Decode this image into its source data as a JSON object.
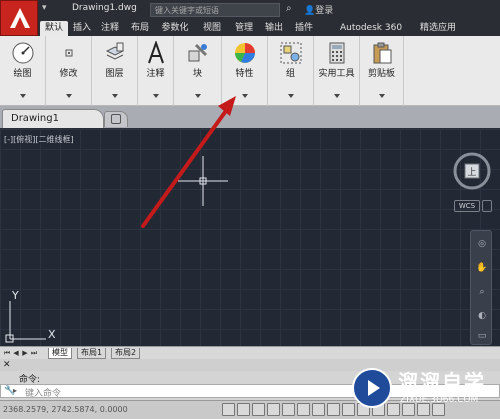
{
  "titlebar": {
    "document_title": "Drawing1.dwg",
    "search_placeholder": "键入关键字或短语",
    "login_label": "登录",
    "qat_glyph": "▾"
  },
  "ribbon_tabs": [
    {
      "label": "默认",
      "active": true
    },
    {
      "label": "插入"
    },
    {
      "label": "注释"
    },
    {
      "label": "布局"
    },
    {
      "label": "参数化"
    },
    {
      "label": "视图"
    },
    {
      "label": "管理"
    },
    {
      "label": "输出"
    },
    {
      "label": "插件"
    },
    {
      "label": "Autodesk 360"
    },
    {
      "label": "精选应用"
    }
  ],
  "ribbon_panels": [
    {
      "label": "绘图",
      "icon": "draw-icon"
    },
    {
      "label": "修改",
      "icon": "modify-icon"
    },
    {
      "label": "图层",
      "icon": "layers-icon"
    },
    {
      "label": "注释",
      "icon": "annotation-icon"
    },
    {
      "label": "块",
      "icon": "block-icon"
    },
    {
      "label": "特性",
      "icon": "properties-icon"
    },
    {
      "label": "组",
      "icon": "group-icon"
    },
    {
      "label": "实用工具",
      "icon": "utilities-icon"
    },
    {
      "label": "剪贴板",
      "icon": "clipboard-icon"
    }
  ],
  "file_tabs": {
    "active_tab": "Drawing1"
  },
  "viewport": {
    "label": "[-][俯视][二维线框]",
    "viewcube_face": "上",
    "wcs_label": "WCS",
    "ucs_y": "Y",
    "ucs_x": "X"
  },
  "layout_tabs": [
    "模型",
    "布局1",
    "布局2"
  ],
  "command": {
    "label": "命令:",
    "placeholder": "键入命令",
    "close_glyph": "✕"
  },
  "status": {
    "coordinates": "2368.2579, 2742.5874, 0.0000"
  },
  "watermark": {
    "brand_cn": "溜溜自学",
    "url": "ZIXUE.3D66.COM"
  },
  "colors": {
    "logo": "#c8251f",
    "canvas": "#222834",
    "annotation_arrow": "#c41a1a"
  }
}
